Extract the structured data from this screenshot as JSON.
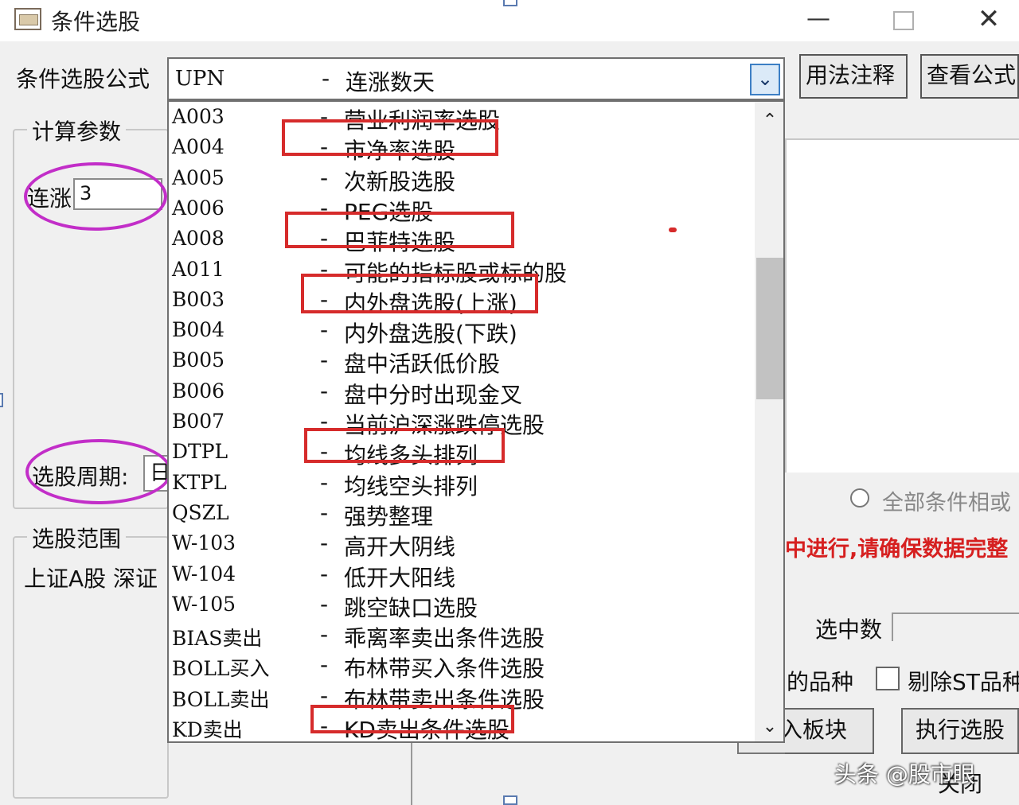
{
  "window": {
    "title": "条件选股",
    "minimize": "—",
    "close": "✕"
  },
  "formula": {
    "label": "条件选股公式",
    "selected_code": "UPN",
    "selected_dash": "-",
    "selected_name": "连涨数天",
    "arrow": "⌄"
  },
  "buttons": {
    "usage": "用法注释",
    "view_formula": "查看公式",
    "join_block": "入板块",
    "execute": "执行选股",
    "close": "关闭"
  },
  "calc_params": {
    "title": "计算参数",
    "consecutive_label": "连涨",
    "consecutive_value": "3",
    "period_label": "选股周期:",
    "period_value": "日"
  },
  "range": {
    "title": "选股范围",
    "text": "上证A股  深证"
  },
  "list": {
    "items": [
      {
        "code": "A003",
        "dash": "-",
        "name": "营业利润率选股"
      },
      {
        "code": "A004",
        "dash": "-",
        "name": "市净率选股"
      },
      {
        "code": "A005",
        "dash": "-",
        "name": "次新股选股"
      },
      {
        "code": "A006",
        "dash": "-",
        "name": "PEG选股"
      },
      {
        "code": "A008",
        "dash": "-",
        "name": "巴菲特选股"
      },
      {
        "code": "A011",
        "dash": "-",
        "name": "可能的指标股或标的股"
      },
      {
        "code": "B003",
        "dash": "-",
        "name": "内外盘选股(上涨)"
      },
      {
        "code": "B004",
        "dash": "-",
        "name": "内外盘选股(下跌)"
      },
      {
        "code": "B005",
        "dash": "-",
        "name": "盘中活跃低价股"
      },
      {
        "code": "B006",
        "dash": "-",
        "name": "盘中分时出现金叉"
      },
      {
        "code": "B007",
        "dash": "-",
        "name": "当前沪深涨跌停选股"
      },
      {
        "code": "DTPL",
        "dash": "-",
        "name": "均线多头排列"
      },
      {
        "code": "KTPL",
        "dash": "-",
        "name": "均线空头排列"
      },
      {
        "code": "QSZL",
        "dash": "-",
        "name": "强势整理"
      },
      {
        "code": "W-103",
        "dash": "-",
        "name": "高开大阴线"
      },
      {
        "code": "W-104",
        "dash": "-",
        "name": "低开大阳线"
      },
      {
        "code": "W-105",
        "dash": "-",
        "name": "跳空缺口选股"
      },
      {
        "code": "BIAS卖出",
        "dash": "-",
        "name": "乖离率卖出条件选股"
      },
      {
        "code": "BOLL买入",
        "dash": "-",
        "name": "布林带买入条件选股"
      },
      {
        "code": "BOLL卖出",
        "dash": "-",
        "name": "布林带卖出条件选股"
      },
      {
        "code": "KD卖出",
        "dash": "-",
        "name": "KD卖出条件选股"
      }
    ],
    "scroll_up": "⌃",
    "scroll_down": "⌄"
  },
  "right_panel": {
    "radio_label": "全部条件相或",
    "warning": "中进行,请确保数据完整",
    "count_label": "选中数",
    "variety_label": "的品种",
    "exclude_st_label": "剔除ST品种"
  },
  "watermark": "头条 @股市眼",
  "colors": {
    "highlight_box": "#d62b2b",
    "highlight_ellipse": "#c22ec8",
    "combo_arrow": "#3c7fc5"
  }
}
